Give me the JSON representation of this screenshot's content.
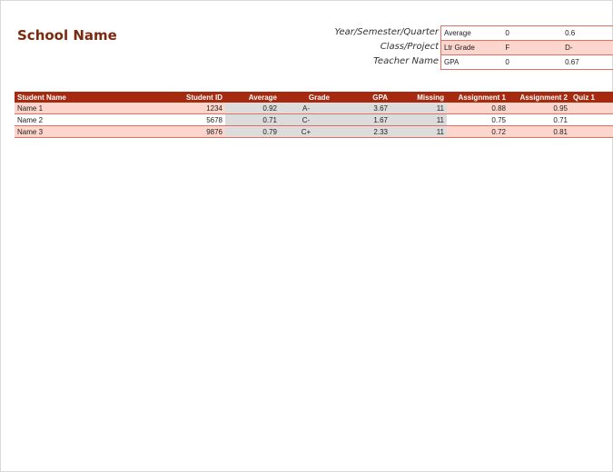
{
  "school_name": "School Name",
  "meta": {
    "labels": [
      "Year/Semester/Quarter",
      "Class/Project",
      "Teacher Name"
    ]
  },
  "scale": [
    {
      "label": "Average",
      "v1": "0",
      "v2": "0.6"
    },
    {
      "label": "Ltr Grade",
      "v1": "F",
      "v2": "D-"
    },
    {
      "label": "GPA",
      "v1": "0",
      "v2": "0.67"
    }
  ],
  "table": {
    "headers": [
      "Student Name",
      "Student ID",
      "Average",
      "Grade",
      "GPA",
      "Missing",
      "Assignment 1",
      "Assignment 2",
      "Quiz 1"
    ],
    "rows": [
      {
        "name": "Name 1",
        "id": "1234",
        "average": "0.92",
        "grade": "A-",
        "gpa": "3.67",
        "missing": "11",
        "a1": "0.88",
        "a2": "0.95",
        "q1": ""
      },
      {
        "name": "Name 2",
        "id": "5678",
        "average": "0.71",
        "grade": "C-",
        "gpa": "1.67",
        "missing": "11",
        "a1": "0.75",
        "a2": "0.71",
        "q1": ""
      },
      {
        "name": "Name 3",
        "id": "9876",
        "average": "0.79",
        "grade": "C+",
        "gpa": "2.33",
        "missing": "11",
        "a1": "0.72",
        "a2": "0.81",
        "q1": ""
      }
    ]
  },
  "colors": {
    "header_bg": "#a52a10",
    "row_tint": "#fcd5cc",
    "border": "#e07060",
    "title": "#7a2a10"
  }
}
